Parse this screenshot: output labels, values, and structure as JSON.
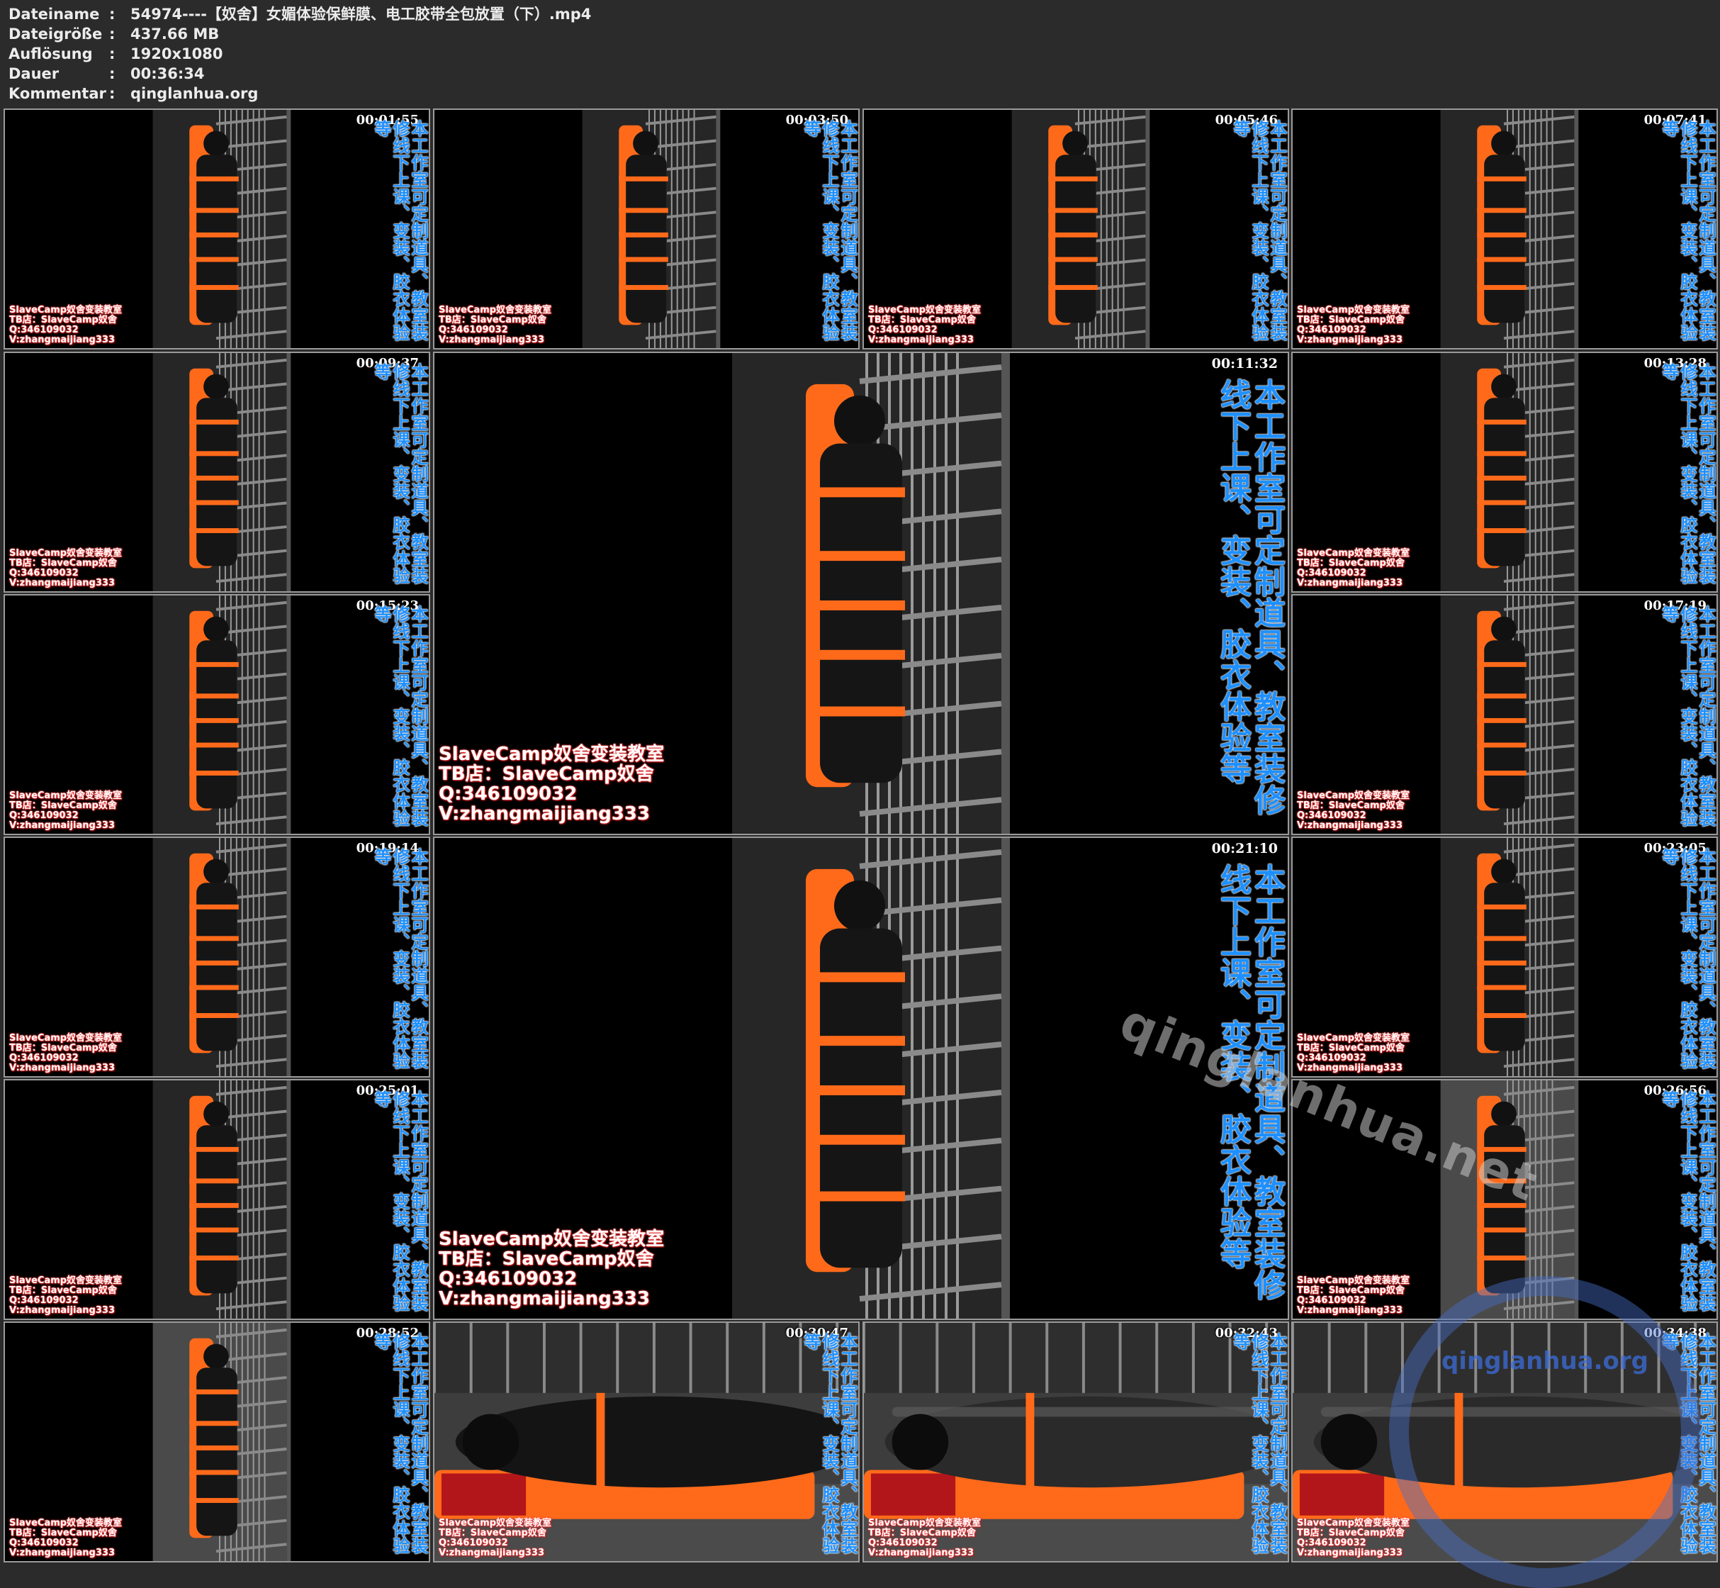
{
  "header": {
    "rows": [
      {
        "label": "Dateiname",
        "value": "54974----【奴舍】女媚体验保鲜膜、电工胶带全包放置（下）.mp4"
      },
      {
        "label": "Dateigröße",
        "value": "437.66 MB"
      },
      {
        "label": "Auflösung",
        "value": "1920x1080"
      },
      {
        "label": "Dauer",
        "value": "00:36:34"
      },
      {
        "label": "Kommentar",
        "value": "qinglanhua.org"
      }
    ],
    "separator": ":"
  },
  "overlay": {
    "watermark_lines": [
      "SlaveCamp奴舍变装教室",
      "TB店：SlaveCamp奴舍",
      "Q:346109032",
      "V:zhangmaijiang333"
    ],
    "vertical_text": "本工作室可定制道具、教室装修线下上课、变装、胶衣体验等"
  },
  "thumbnails": [
    {
      "timestamp": "00:01:55",
      "scene": "standing"
    },
    {
      "timestamp": "00:03:50",
      "scene": "standing"
    },
    {
      "timestamp": "00:05:46",
      "scene": "standing"
    },
    {
      "timestamp": "00:07:41",
      "scene": "standing"
    },
    {
      "timestamp": "00:09:37",
      "scene": "standing"
    },
    {
      "timestamp": "00:11:32",
      "scene": "standing"
    },
    {
      "timestamp": "00:13:28",
      "scene": "standing"
    },
    {
      "timestamp": "00:15:23",
      "scene": "standing"
    },
    {
      "timestamp": "00:17:19",
      "scene": "standing"
    },
    {
      "timestamp": "00:19:14",
      "scene": "standing"
    },
    {
      "timestamp": "00:21:10",
      "scene": "standing"
    },
    {
      "timestamp": "00:23:05",
      "scene": "standing"
    },
    {
      "timestamp": "00:25:01",
      "scene": "standing"
    },
    {
      "timestamp": "00:26:56",
      "scene": "standing-lit"
    },
    {
      "timestamp": "00:28:52",
      "scene": "standing-lit"
    },
    {
      "timestamp": "00:30:47",
      "scene": "lying-black"
    },
    {
      "timestamp": "00:32:43",
      "scene": "lying-wrapped"
    },
    {
      "timestamp": "00:34:38",
      "scene": "lying-wrapped"
    }
  ],
  "site_watermark": "qinglanhua.net",
  "logo_text": "qinglanhua.org",
  "colors": {
    "accent_orange": "#ff6a1a",
    "vertical_text": "#1e90ff",
    "watermark_glow": "#ff4a4a"
  }
}
